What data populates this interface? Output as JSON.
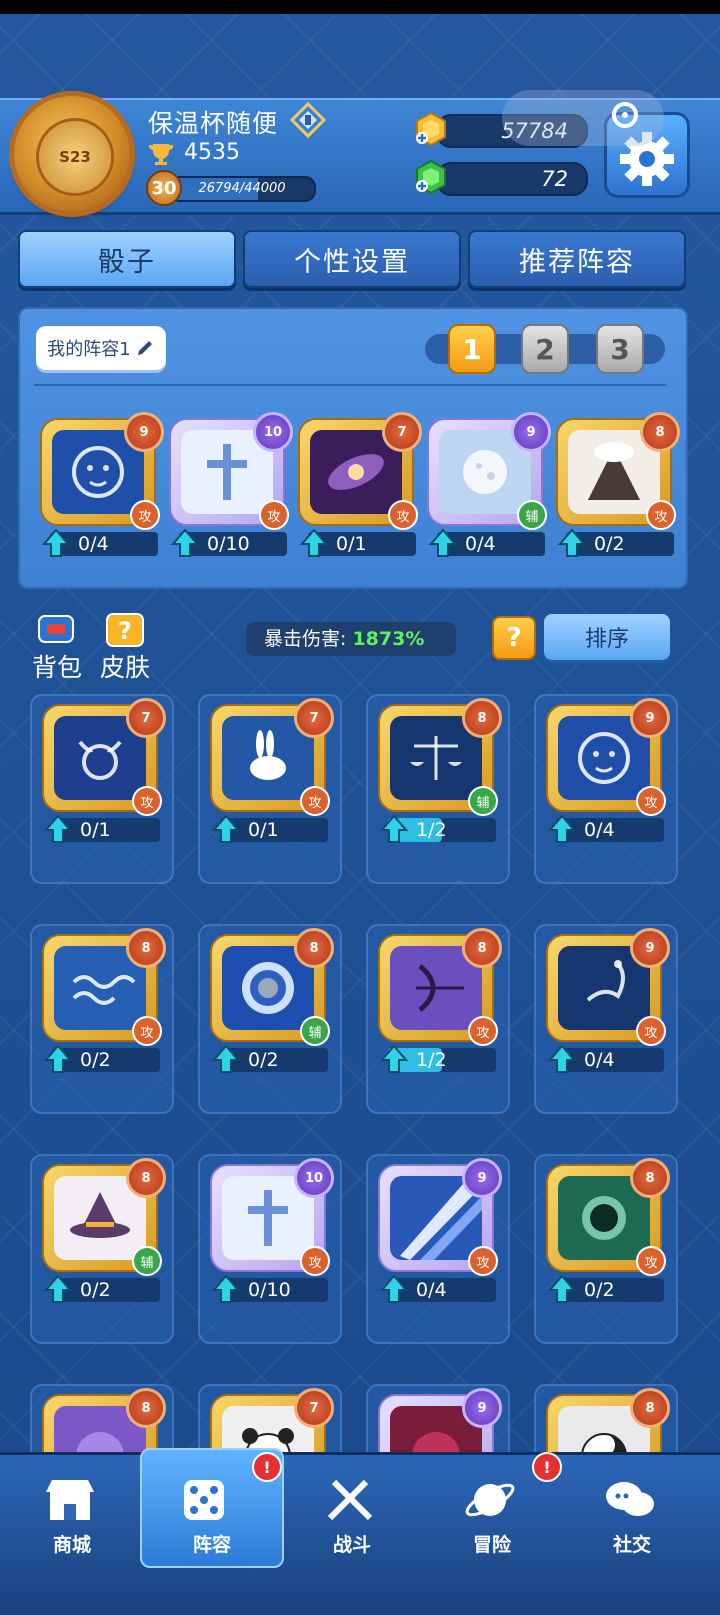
{
  "player": {
    "name": "保温杯随便",
    "season": "S23",
    "trophies": "4535",
    "level": "30",
    "xp_text": "26794/44000",
    "xp_fraction": 0.609
  },
  "currency": {
    "gold": "57784",
    "gems": "72"
  },
  "tabs": [
    {
      "label": "骰子",
      "active": true
    },
    {
      "label": "个性设置",
      "active": false
    },
    {
      "label": "推荐阵容",
      "active": false
    }
  ],
  "lineup": {
    "label": "我的阵容1",
    "presets": [
      "1",
      "2",
      "3"
    ],
    "dice": [
      {
        "icon": "lion-icon",
        "level": "9",
        "role": "攻",
        "progress": "0/4",
        "fill": 0,
        "frame": "gold",
        "color": "#1f4fa8"
      },
      {
        "icon": "holy-cross-icon",
        "level": "10",
        "role": "攻",
        "progress": "0/10",
        "fill": 0,
        "frame": "purple",
        "color": "#e9f1ff"
      },
      {
        "icon": "galaxy-icon",
        "level": "7",
        "role": "攻",
        "progress": "0/1",
        "fill": 0,
        "frame": "gold",
        "color": "#3a1d5a"
      },
      {
        "icon": "moon-icon",
        "level": "9",
        "role": "辅",
        "progress": "0/4",
        "fill": 0,
        "frame": "purple",
        "color": "#bcd6f2"
      },
      {
        "icon": "volcano-icon",
        "level": "8",
        "role": "攻",
        "progress": "0/2",
        "fill": 0,
        "frame": "gold",
        "color": "#f2ede6"
      }
    ]
  },
  "tools": {
    "backpack": "背包",
    "skin": "皮肤",
    "crit_label": "暴击伤害:",
    "crit_value": "1873%",
    "sort": "排序"
  },
  "collection": [
    {
      "icon": "taurus-icon",
      "level": "7",
      "role": "攻",
      "progress": "0/1",
      "fill": 0,
      "frame": "gold",
      "color": "#1d3f8e"
    },
    {
      "icon": "rabbit-icon",
      "level": "7",
      "role": "攻",
      "progress": "0/1",
      "fill": 0,
      "frame": "gold",
      "color": "#2358a6"
    },
    {
      "icon": "libra-icon",
      "level": "8",
      "role": "辅",
      "progress": "1/2",
      "fill": 0.5,
      "frame": "gold",
      "color": "#16366f"
    },
    {
      "icon": "lion-icon",
      "level": "9",
      "role": "攻",
      "progress": "0/4",
      "fill": 0,
      "frame": "gold",
      "color": "#1f4fa8"
    },
    {
      "icon": "aquarius-icon",
      "level": "8",
      "role": "攻",
      "progress": "0/2",
      "fill": 0,
      "frame": "gold",
      "color": "#2560b5"
    },
    {
      "icon": "shield-icon",
      "level": "8",
      "role": "辅",
      "progress": "0/2",
      "fill": 0,
      "frame": "gold",
      "color": "#1c4fb0"
    },
    {
      "icon": "archer-icon",
      "level": "8",
      "role": "攻",
      "progress": "1/2",
      "fill": 0.5,
      "frame": "gold",
      "color": "#6b4fbf"
    },
    {
      "icon": "scorpion-icon",
      "level": "9",
      "role": "攻",
      "progress": "0/4",
      "fill": 0,
      "frame": "gold",
      "color": "#16366f"
    },
    {
      "icon": "witch-hat-icon",
      "level": "8",
      "role": "辅",
      "progress": "0/2",
      "fill": 0,
      "frame": "gold",
      "color": "#f3eef6"
    },
    {
      "icon": "holy-cross-icon",
      "level": "10",
      "role": "攻",
      "progress": "0/10",
      "fill": 0,
      "frame": "purple",
      "color": "#e9f1ff"
    },
    {
      "icon": "light-beam-icon",
      "level": "9",
      "role": "攻",
      "progress": "0/4",
      "fill": 0,
      "frame": "purple",
      "color": "#2a58b8"
    },
    {
      "icon": "ghost-icon",
      "level": "8",
      "role": "攻",
      "progress": "0/2",
      "fill": 0,
      "frame": "gold",
      "color": "#1f6a52"
    },
    {
      "icon": "purple-blob-icon",
      "level": "8",
      "role": "",
      "progress": "",
      "fill": 0,
      "frame": "gold",
      "color": "#7d58c8"
    },
    {
      "icon": "panda-icon",
      "level": "7",
      "role": "",
      "progress": "",
      "fill": 0,
      "frame": "gold",
      "color": "#f0f0f0"
    },
    {
      "icon": "crimson-icon",
      "level": "9",
      "role": "",
      "progress": "",
      "fill": 0,
      "frame": "purple",
      "color": "#7a1d3a"
    },
    {
      "icon": "yin-yang-icon",
      "level": "8",
      "role": "",
      "progress": "",
      "fill": 0,
      "frame": "gold",
      "color": "#eaeaea"
    }
  ],
  "nav": [
    {
      "label": "商城",
      "icon": "shop-icon",
      "badge": ""
    },
    {
      "label": "阵容",
      "icon": "dice-icon",
      "badge": "!",
      "active": true
    },
    {
      "label": "战斗",
      "icon": "swords-icon",
      "badge": ""
    },
    {
      "label": "冒险",
      "icon": "planet-icon",
      "badge": "!"
    },
    {
      "label": "社交",
      "icon": "chat-icon",
      "badge": ""
    }
  ]
}
